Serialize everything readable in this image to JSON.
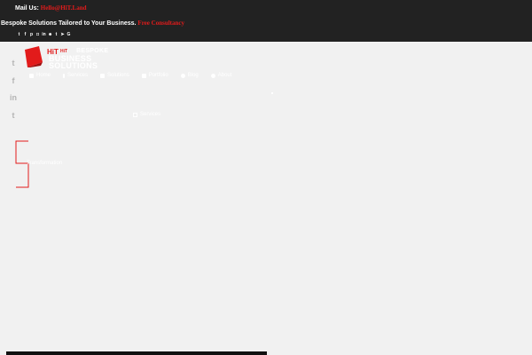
{
  "topbar": {
    "mail_label": "Mail Us: ",
    "mail_link": "Hello@HiT.Land",
    "tagline": "Bespoke Solutions Tailored to Your Business. ",
    "tagline_link": "Free Consultancy",
    "social_icons": [
      "twitter-icon",
      "facebook-icon",
      "pinterest-icon",
      "instagram-icon",
      "linkedin-icon",
      "snapchat-icon",
      "tumblr-icon",
      "telegram-icon",
      "google-icon"
    ]
  },
  "side_social": [
    "twitter-icon",
    "facebook-icon",
    "linkedin-icon",
    "tumblr-icon"
  ],
  "logo": {
    "hit": "HiT",
    "hit_small": "HiT",
    "line1": "BESPOKE",
    "line2": "BUSINESS",
    "line3": "SOLUTIONS"
  },
  "nav": {
    "items": [
      {
        "label": "Home",
        "icon": "home-icon"
      },
      {
        "label": "Services",
        "icon": "services-icon"
      },
      {
        "label": "Solutions",
        "icon": "solutions-icon"
      },
      {
        "label": "Portfolio",
        "icon": "portfolio-icon"
      },
      {
        "label": "Blog",
        "icon": "blog-icon"
      },
      {
        "label": "About",
        "icon": "about-icon"
      }
    ]
  },
  "services_button": "Services",
  "bracket_text": "Transformation",
  "colors": {
    "topbar": "#222222",
    "accent": "#e21b1b",
    "background": "#f1f1f1"
  }
}
